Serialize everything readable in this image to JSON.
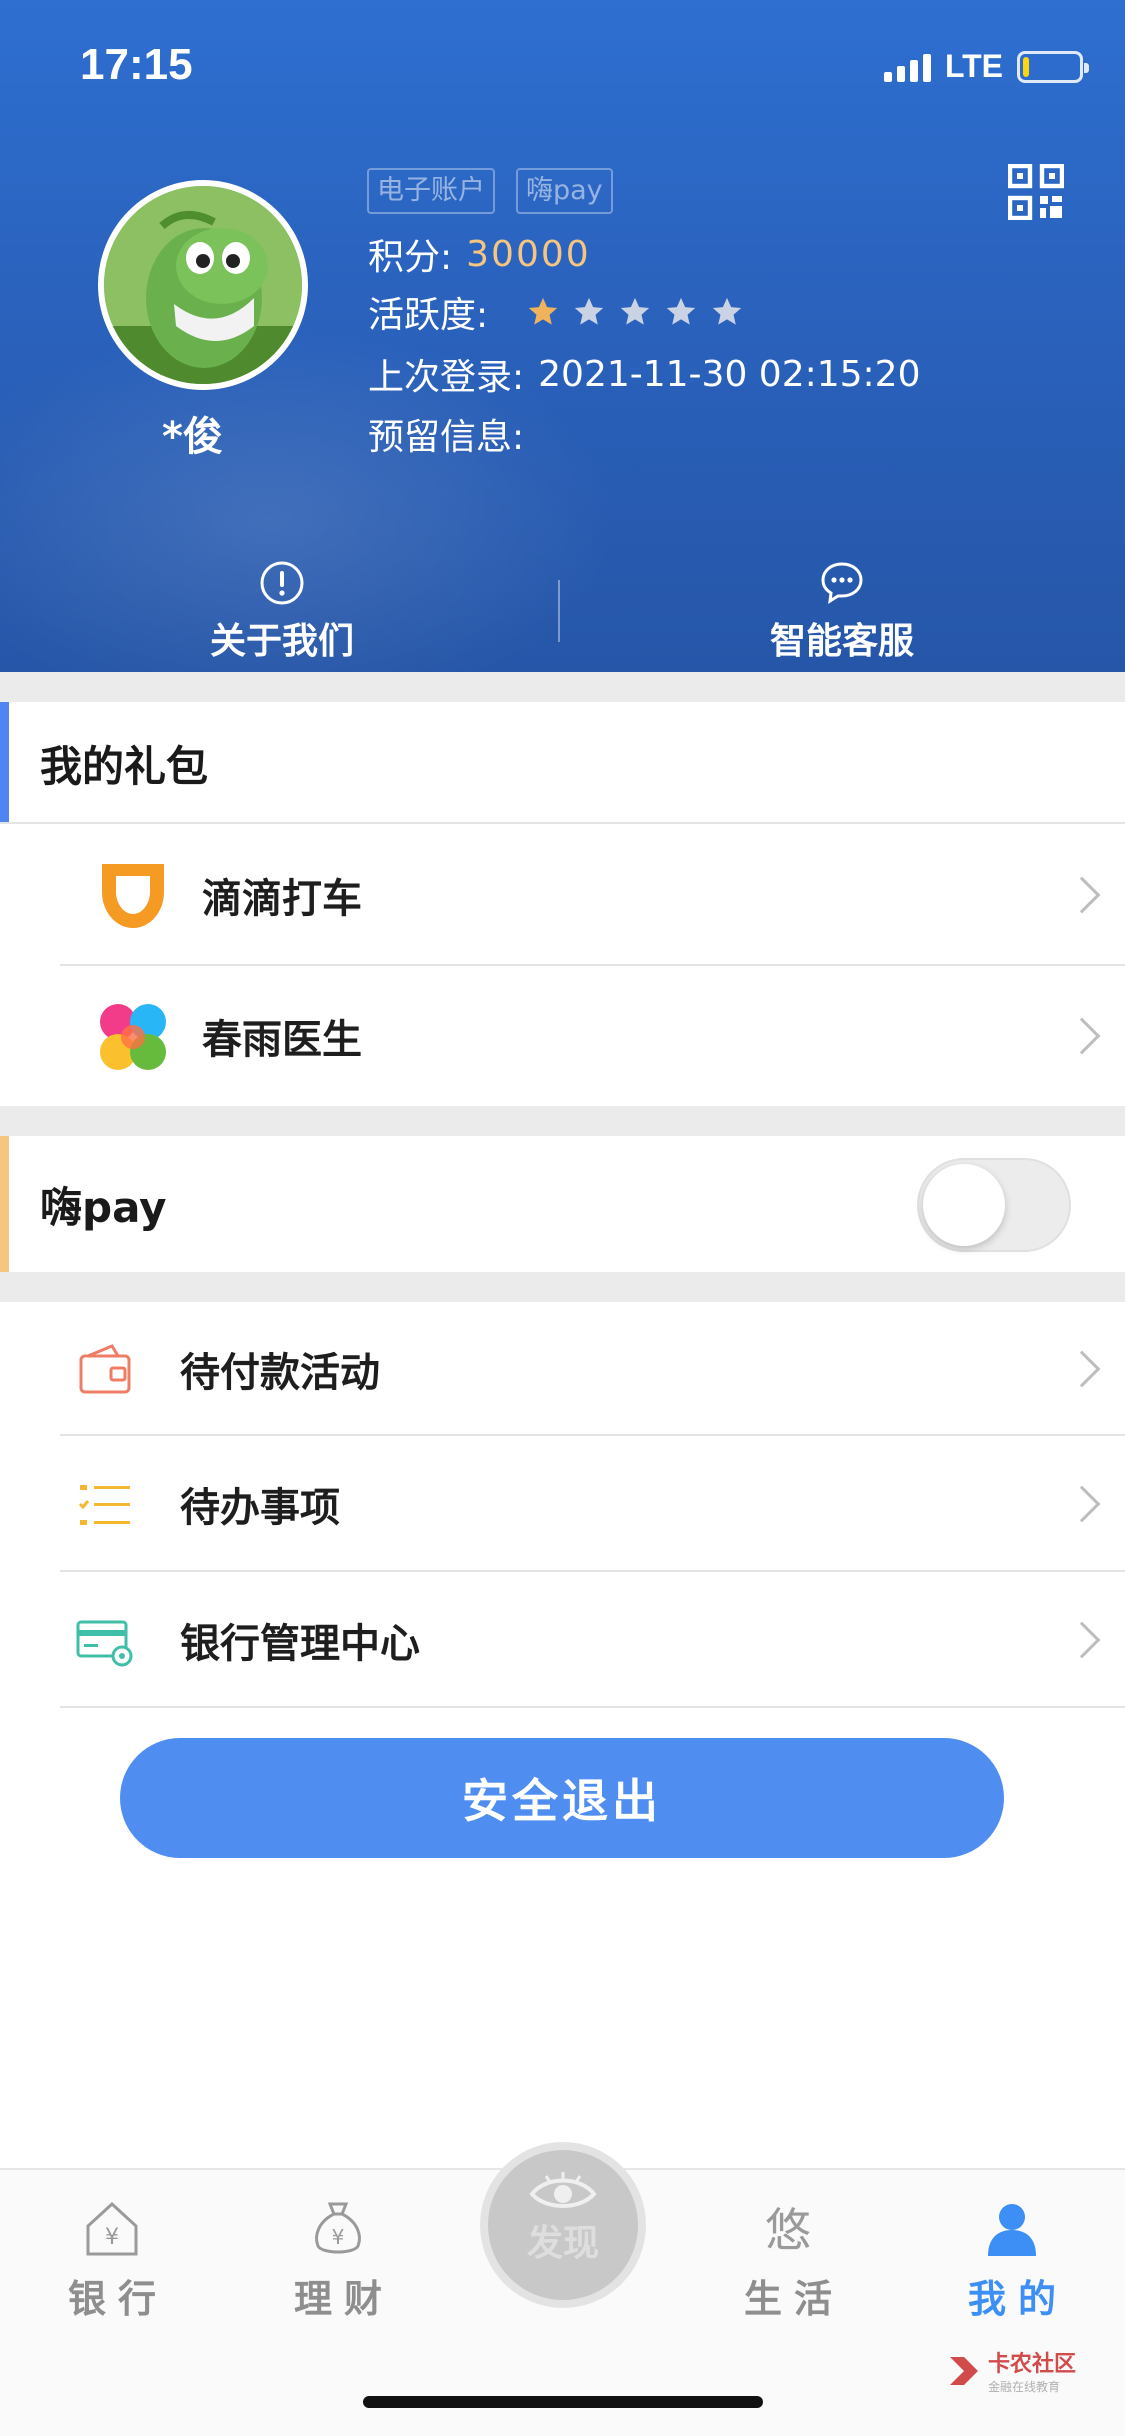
{
  "status_bar": {
    "time": "17:15",
    "network": "LTE"
  },
  "profile": {
    "username": "*俊",
    "tags": [
      "电子账户",
      "嗨pay"
    ],
    "points_label": "积分:",
    "points_value": "30000",
    "activity_label": "活跃度:",
    "activity_stars": 1,
    "activity_max": 5,
    "last_login_label": "上次登录:",
    "last_login_value": "2021-11-30 02:15:20",
    "reserved_label": "预留信息:",
    "reserved_value": ""
  },
  "header_actions": {
    "about": "关于我们",
    "service": "智能客服"
  },
  "gift_section": {
    "title": "我的礼包",
    "accent": "#4f84f3",
    "items": [
      {
        "label": "滴滴打车",
        "icon": "didi-icon"
      },
      {
        "label": "春雨医生",
        "icon": "chunyu-icon"
      }
    ]
  },
  "haipay": {
    "label": "嗨pay",
    "accent": "#f6c57f",
    "enabled": false
  },
  "menu": [
    {
      "label": "待付款活动",
      "icon": "wallet-icon"
    },
    {
      "label": "待办事项",
      "icon": "checklist-icon"
    },
    {
      "label": "银行管理中心",
      "icon": "bank-card-settings-icon"
    }
  ],
  "logout_label": "安全退出",
  "tabbar": {
    "bank": "银行",
    "finance": "理财",
    "discover": "发现",
    "life": "生活",
    "mine": "我的",
    "active_color": "#3d8ef5"
  },
  "watermark": {
    "title": "卡农社区",
    "subtitle": "金融在线教育"
  }
}
